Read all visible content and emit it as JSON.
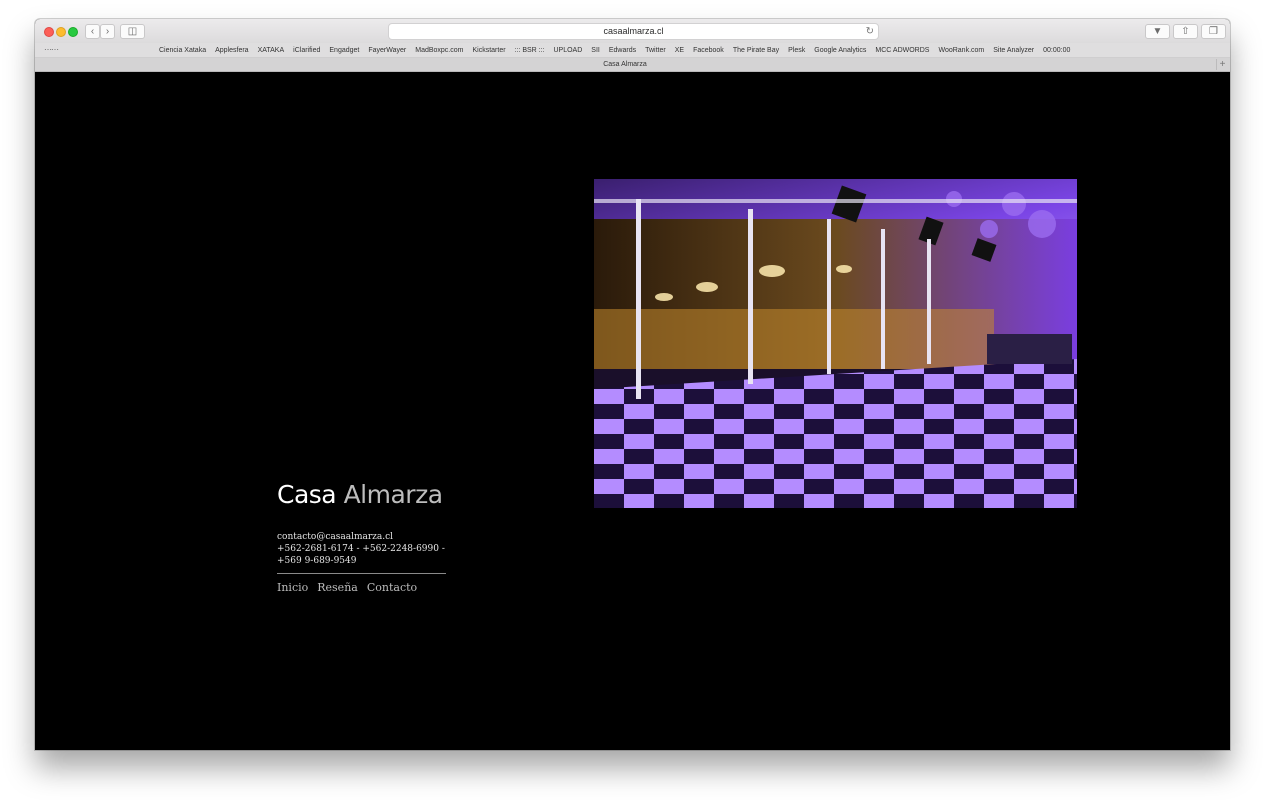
{
  "browser": {
    "url": "casaalmarza.cl",
    "tab_title": "Casa Almarza",
    "bookmarks": [
      "Ciencia Xataka",
      "Applesfera",
      "XATAKA",
      "iClarified",
      "Engadget",
      "FayerWayer",
      "MadBoxpc.com",
      "Kickstarter",
      "::: BSR :::",
      "UPLOAD",
      "SII",
      "Edwards",
      "Twitter",
      "XE",
      "Facebook",
      "The Pirate Bay",
      "Plesk",
      "Google Analytics",
      "MCC ADWORDS",
      "WooRank.com",
      "Site Analyzer",
      "00:00:00"
    ],
    "icons": {
      "back": "chevron-left-icon",
      "forward": "chevron-right-icon",
      "sidebar": "sidebar-icon",
      "reload": "reload-icon",
      "download": "download-icon",
      "share": "share-icon",
      "tabs": "tabs-icon",
      "apps": "grid-icon",
      "new_tab": "plus-icon"
    }
  },
  "site": {
    "brand_first": "Casa",
    "brand_second": "Almarza",
    "email": "contacto@casaalmarza.cl",
    "phones_line1": "+562-2681-6174 - +562-2248-6990 -",
    "phones_line2": "+569 9-689-9549",
    "nav": [
      "Inicio",
      "Reseña",
      "Contacto"
    ]
  },
  "colors": {
    "background": "#000000",
    "accent_purple": "#8a3ee8"
  }
}
